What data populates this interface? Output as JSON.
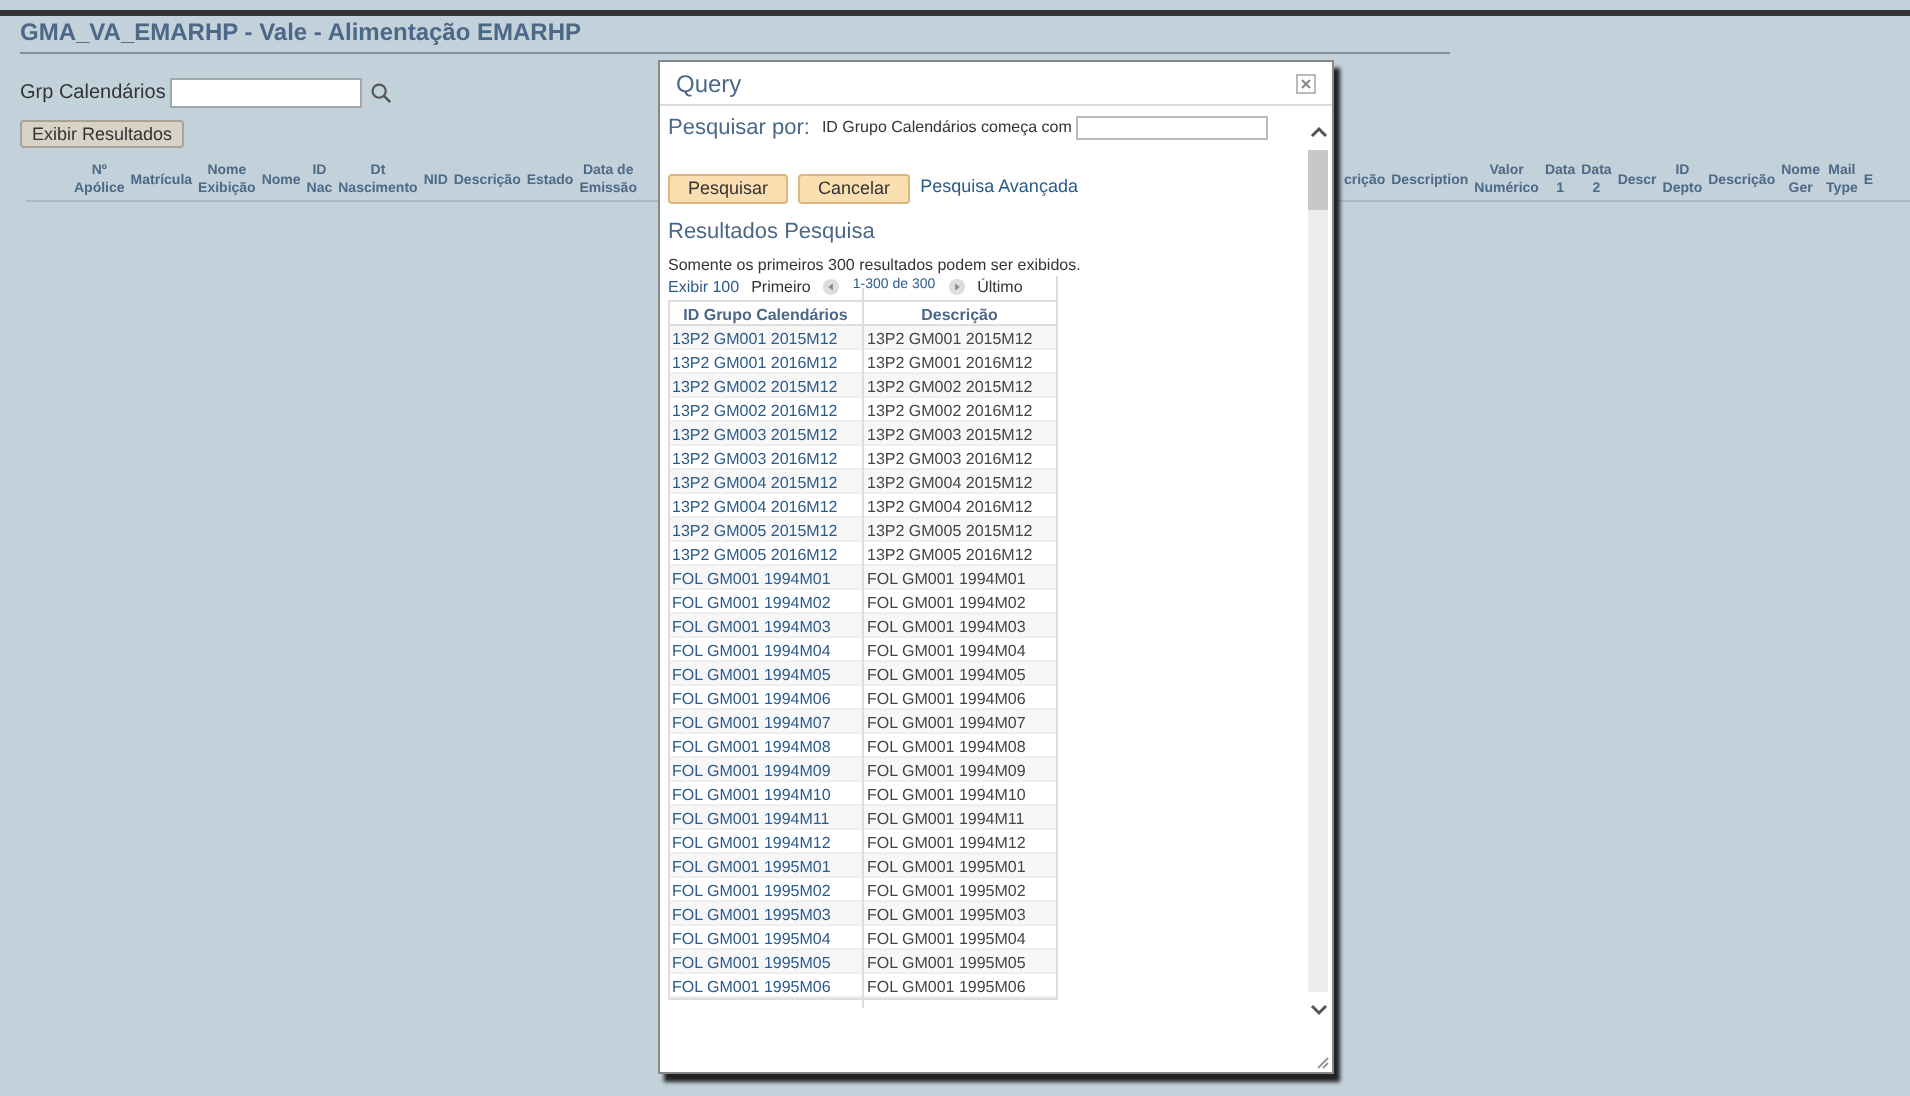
{
  "page": {
    "title": "GMA_VA_EMARHP - Vale - Alimentação EMARHP",
    "filter_label": "Grp Calendários",
    "show_results_button": "Exibir Resultados"
  },
  "grid": {
    "columns_left": [
      "Nº\nApólice",
      "Matrícula",
      "Nome\nExibição",
      "Nome",
      "ID\nNac",
      "Dt\nNascimento",
      "NID",
      "Descrição",
      "Estado",
      "Data de\nEmissão"
    ],
    "columns_right": [
      "crição",
      "Description",
      "Valor\nNumérico",
      "Data\n1",
      "Data\n2",
      "Descr",
      "ID\nDepto",
      "Descrição",
      "Nome\nGer",
      "Mail\nType",
      "E"
    ]
  },
  "dialog": {
    "title": "Query",
    "search_by_label": "Pesquisar por:",
    "field_label": "ID Grupo Calendários começa com",
    "buttons": [
      "Pesquisar",
      "Cancelar"
    ],
    "advanced_link": "Pesquisa Avançada",
    "results_title": "Resultados Pesquisa",
    "notice": "Somente os primeiros 300 resultados podem ser exibidos.",
    "nav": {
      "show": "Exibir 100",
      "first": "Primeiro",
      "range": "1-300 de 300",
      "last": "Último"
    },
    "columns": [
      "ID Grupo Calendários",
      "Descrição"
    ],
    "rows": [
      {
        "id": "13P2 GM001 2015M12",
        "description": "13P2 GM001 2015M12"
      },
      {
        "id": "13P2 GM001 2016M12",
        "description": "13P2 GM001 2016M12"
      },
      {
        "id": "13P2 GM002 2015M12",
        "description": "13P2 GM002 2015M12"
      },
      {
        "id": "13P2 GM002 2016M12",
        "description": "13P2 GM002 2016M12"
      },
      {
        "id": "13P2 GM003 2015M12",
        "description": "13P2 GM003 2015M12"
      },
      {
        "id": "13P2 GM003 2016M12",
        "description": "13P2 GM003 2016M12"
      },
      {
        "id": "13P2 GM004 2015M12",
        "description": "13P2 GM004 2015M12"
      },
      {
        "id": "13P2 GM004 2016M12",
        "description": "13P2 GM004 2016M12"
      },
      {
        "id": "13P2 GM005 2015M12",
        "description": "13P2 GM005 2015M12"
      },
      {
        "id": "13P2 GM005 2016M12",
        "description": "13P2 GM005 2016M12"
      },
      {
        "id": "FOL GM001 1994M01",
        "description": "FOL GM001 1994M01"
      },
      {
        "id": "FOL GM001 1994M02",
        "description": "FOL GM001 1994M02"
      },
      {
        "id": "FOL GM001 1994M03",
        "description": "FOL GM001 1994M03"
      },
      {
        "id": "FOL GM001 1994M04",
        "description": "FOL GM001 1994M04"
      },
      {
        "id": "FOL GM001 1994M05",
        "description": "FOL GM001 1994M05"
      },
      {
        "id": "FOL GM001 1994M06",
        "description": "FOL GM001 1994M06"
      },
      {
        "id": "FOL GM001 1994M07",
        "description": "FOL GM001 1994M07"
      },
      {
        "id": "FOL GM001 1994M08",
        "description": "FOL GM001 1994M08"
      },
      {
        "id": "FOL GM001 1994M09",
        "description": "FOL GM001 1994M09"
      },
      {
        "id": "FOL GM001 1994M10",
        "description": "FOL GM001 1994M10"
      },
      {
        "id": "FOL GM001 1994M11",
        "description": "FOL GM001 1994M11"
      },
      {
        "id": "FOL GM001 1994M12",
        "description": "FOL GM001 1994M12"
      },
      {
        "id": "FOL GM001 1995M01",
        "description": "FOL GM001 1995M01"
      },
      {
        "id": "FOL GM001 1995M02",
        "description": "FOL GM001 1995M02"
      },
      {
        "id": "FOL GM001 1995M03",
        "description": "FOL GM001 1995M03"
      },
      {
        "id": "FOL GM001 1995M04",
        "description": "FOL GM001 1995M04"
      },
      {
        "id": "FOL GM001 1995M05",
        "description": "FOL GM001 1995M05"
      },
      {
        "id": "FOL GM001 1995M06",
        "description": "FOL GM001 1995M06"
      }
    ]
  }
}
